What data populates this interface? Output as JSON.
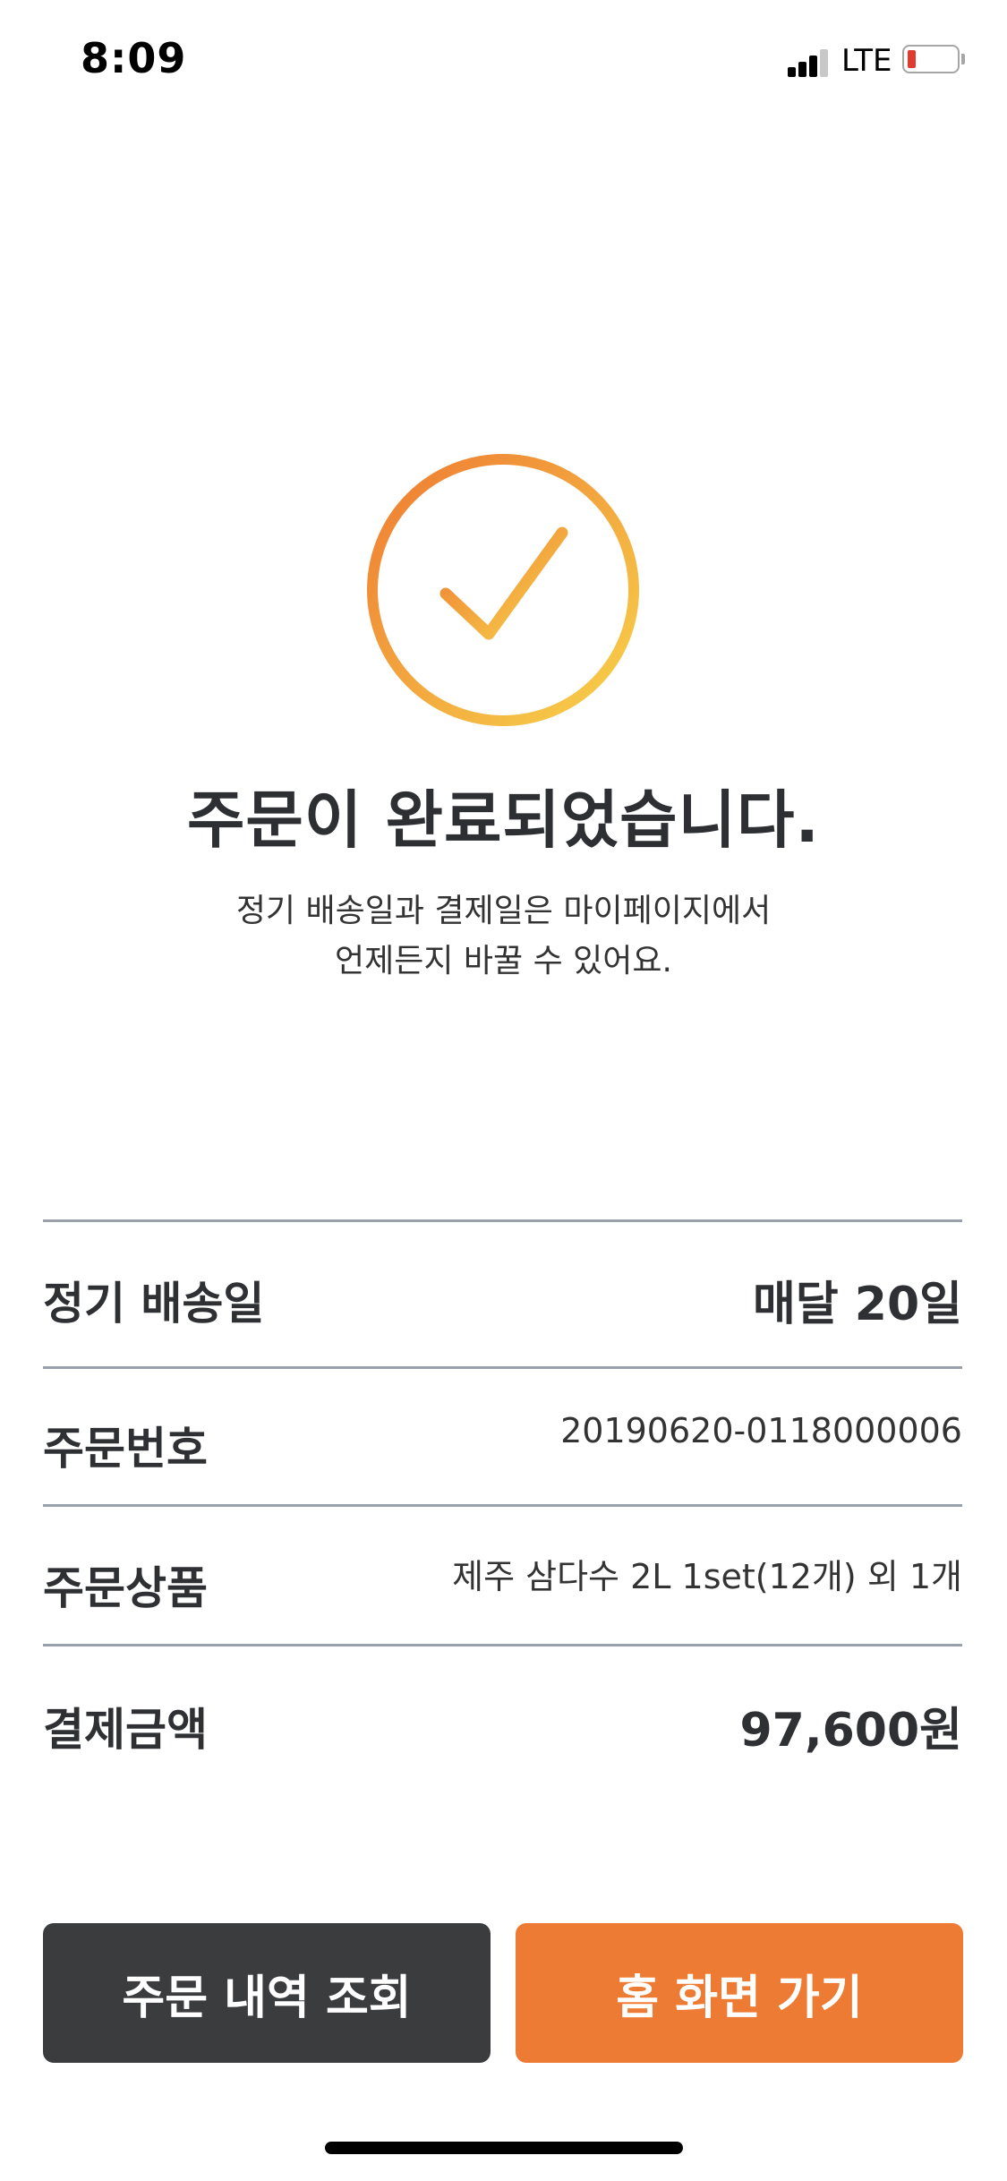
{
  "status_bar": {
    "time": "8:09",
    "network": "LTE",
    "battery_color": "#e03b30"
  },
  "success": {
    "icon": "check-circle-icon",
    "gradient_start": "#ee7b33",
    "gradient_end": "#f7d24a",
    "title": "주문이 완료되었습니다.",
    "message_line1": "정기 배송일과 결제일은 마이페이지에서",
    "message_line2": "언제든지 바꿀 수 있어요."
  },
  "details": [
    {
      "label": "정기 배송일",
      "value": "매달 20일"
    },
    {
      "label": "주문번호",
      "value": "20190620-0118000006"
    },
    {
      "label": "주문상품",
      "value": "제주 삼다수 2L 1set(12개) 외 1개"
    },
    {
      "label": "결제금액",
      "value": "97,600원"
    }
  ],
  "buttons": {
    "history_label": "주문 내역 조회",
    "home_label": "홈 화면 가기",
    "history_color": "#3b3c3e",
    "home_color": "#ee7b33"
  }
}
